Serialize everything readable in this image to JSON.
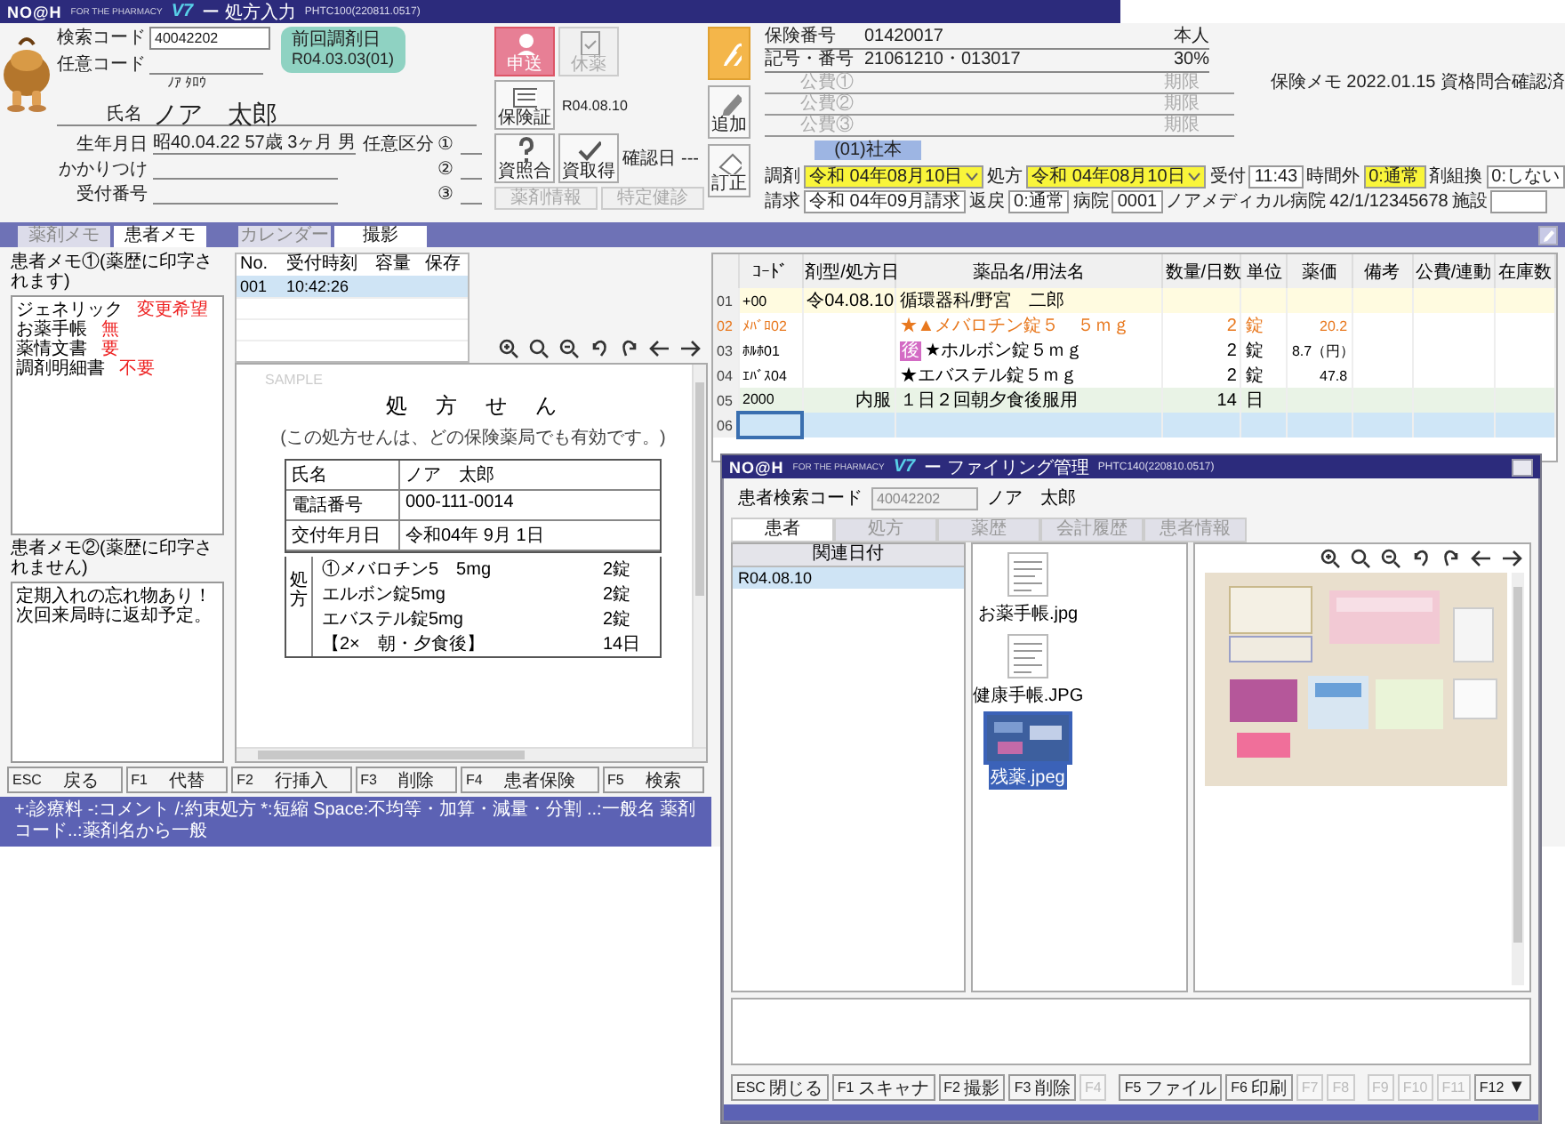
{
  "prescription_window": {
    "title_bar": {
      "logo": "NO@H",
      "tagline": "FOR THE PHARMACY",
      "badge": "V7",
      "title": "ー 処方入力",
      "build": "PHTC100(220811.0517)"
    },
    "patient": {
      "search_code_label": "検索コード",
      "search_code": "40042202",
      "optional_code_label": "任意コード",
      "kana": "ﾉｱ ﾀﾛｳ",
      "name_label": "氏名",
      "name": "ノア　太郎",
      "birth_label": "生年月日",
      "birth": "昭40.04.22 57歳 3ヶ月 男",
      "family_label": "かかりつけ",
      "reception_label": "受付番号",
      "category_label": "任意区分",
      "category_slots": [
        "①",
        "②",
        "③"
      ]
    },
    "last_dispense": {
      "label": "前回調剤日",
      "date": "R04.03.03(01)"
    },
    "buttons": [
      {
        "label": "申送",
        "kind": "person",
        "disabled": false
      },
      {
        "label": "休薬",
        "kind": "document",
        "disabled": true
      },
      {
        "label": "保険証",
        "kind": "card",
        "disabled": false
      },
      {
        "label": "資照合",
        "kind": "question",
        "disabled": false
      },
      {
        "label": "資取得",
        "kind": "check",
        "disabled": false
      },
      {
        "label": "薬剤情報",
        "kind": "plain",
        "disabled": true
      },
      {
        "label": "特定健診",
        "kind": "plain",
        "disabled": true
      }
    ],
    "card_date": "R04.08.10",
    "confirm_label": "確認日",
    "confirm_value": "---",
    "side_buttons": [
      {
        "kind": "clip",
        "highlighted": true
      },
      {
        "kind": "pencil",
        "label": "追加",
        "highlighted": false
      },
      {
        "kind": "eraser",
        "label": "訂正",
        "highlighted": false
      }
    ],
    "insurance": {
      "rows": [
        {
          "label": "保険番号",
          "value": "01420017",
          "extra": "本人"
        },
        {
          "label": "記号・番号",
          "value": "21061210・013017",
          "extra": "30%"
        }
      ],
      "public": [
        {
          "label": "公費①",
          "limit": "期限"
        },
        {
          "label": "公費②",
          "limit": "期限"
        },
        {
          "label": "公費③",
          "limit": "期限"
        }
      ],
      "memo_label": "保険メモ",
      "memo": "2022.01.15 資格問合確認済",
      "type": "(01)社本"
    },
    "dispense_rows": [
      {
        "fields": [
          {
            "label": "調剤",
            "value": "令和 04年08月10日",
            "kind": "dropdown",
            "highlighted": true
          },
          {
            "label": "処方",
            "value": "令和 04年08月10日",
            "kind": "dropdown",
            "highlighted": true
          },
          {
            "label": "受付",
            "value": "11:43",
            "kind": "input",
            "highlighted": false
          },
          {
            "label": "時間外",
            "value": "0:通常",
            "kind": "input",
            "highlighted": true
          },
          {
            "label": "剤組換",
            "value": "0:しない",
            "kind": "input",
            "highlighted": false
          }
        ]
      },
      {
        "fields": [
          {
            "label": "請求",
            "value": "令和 04年09月請求",
            "kind": "input",
            "highlighted": false
          },
          {
            "label": "返戻",
            "value": "0:通常",
            "kind": "input",
            "highlighted": false
          },
          {
            "label": "病院",
            "value": "0001",
            "kind": "input",
            "highlighted": false
          },
          {
            "value": "ノアメディカル病院",
            "kind": "text"
          },
          {
            "value": "42/1/12345678",
            "kind": "text"
          },
          {
            "label": "施設",
            "kind": "input",
            "highlighted": false
          }
        ]
      }
    ],
    "tabs_left": [
      {
        "label": "薬剤メモ",
        "selected": false
      },
      {
        "label": "患者メモ",
        "selected": true
      }
    ],
    "tabs_center": [
      {
        "label": "カレンダー",
        "selected": false
      },
      {
        "label": "撮影",
        "selected": true
      }
    ],
    "memo1": {
      "title": "患者メモ①(薬歴に印字されます)",
      "lines": [
        {
          "label": "ジェネリック",
          "value": "変更希望"
        },
        {
          "label": "お薬手帳",
          "value": "無"
        },
        {
          "label": "薬情文書",
          "value": "要"
        },
        {
          "label": "調剤明細書",
          "value": "不要"
        }
      ]
    },
    "memo2": {
      "title": "患者メモ②(薬歴に印字されません)",
      "lines": [
        "定期入れの忘れ物あり！",
        "次回来局時に返却予定。"
      ]
    },
    "captures": {
      "columns": [
        "No.",
        "受付時刻",
        "容量",
        "保存"
      ],
      "rows": [
        {
          "cells": [
            "001",
            "10:42:26"
          ],
          "selected": true
        }
      ]
    },
    "document": {
      "watermark": "SAMPLE",
      "title": "処　方　せ　ん",
      "note": "(この処方せんは、どの保険薬局でも有効です。)",
      "rows": [
        {
          "label": "氏名",
          "value": "ノア　太郎"
        },
        {
          "label": "電話番号",
          "value": "000-111-0014"
        },
        {
          "label": "交付年月日",
          "value": "令和04年 9月 1日"
        }
      ],
      "section_label": "処方",
      "items": [
        {
          "drug": "①メバロチン5　5mg",
          "amount": "2錠"
        },
        {
          "drug": "エルボン錠5mg",
          "amount": "2錠"
        },
        {
          "drug": "エバステル錠5mg",
          "amount": "2錠"
        },
        {
          "drug": "【2×　朝・夕食後】",
          "amount": "14日"
        }
      ]
    },
    "drugs": {
      "columns": [
        "ｺｰﾄﾞ",
        "剤型/処方日",
        "薬品名/用法名",
        "数量/日数",
        "単位",
        "薬価",
        "備考",
        "公費/連動",
        "在庫数"
      ],
      "rows": [
        {
          "no": "01",
          "kind": "doctor",
          "code": "+00",
          "form": "令04.08.10",
          "name": "循環器科/野宮　二郎",
          "selected": false
        },
        {
          "no": "02",
          "kind": "drug",
          "code": "ﾒﾊﾞﾛ02",
          "name": "★▲メバロチン錠５　５ｍｇ",
          "qty": "2",
          "unit": "錠",
          "price": "20.2",
          "alert": true,
          "selected": false
        },
        {
          "no": "03",
          "kind": "drug",
          "code": "ﾎﾙﾎ01",
          "badge": "後",
          "name": "★ホルボン錠５ｍｇ",
          "qty": "2",
          "unit": "錠",
          "price": "8.7（円）",
          "alert": false,
          "selected": false
        },
        {
          "no": "04",
          "kind": "drug",
          "code": "ｴﾊﾞｽ04",
          "name": "★エバステル錠５ｍｇ",
          "qty": "2",
          "unit": "錠",
          "price": "47.8",
          "alert": false,
          "selected": false
        },
        {
          "no": "05",
          "kind": "usage",
          "code": "2000",
          "form": "内服",
          "name": "１日２回朝夕食後服用",
          "qty": "14",
          "unit": "日",
          "selected": false
        },
        {
          "no": "06",
          "kind": "empty",
          "selected": true
        }
      ]
    },
    "fkeys": [
      {
        "key": "ESC",
        "label": "戻る"
      },
      {
        "key": "F1",
        "label": "代替"
      },
      {
        "key": "F2",
        "label": "行挿入"
      },
      {
        "key": "F3",
        "label": "削除"
      },
      {
        "key": "F4",
        "label": "患者保険"
      },
      {
        "key": "F5",
        "label": "検索"
      }
    ],
    "status": "+:診療料 -:コメント /:約束処方 *:短縮 Space:不均等・加算・減量・分割 ..:一般名 薬剤コード..:薬剤名から一般"
  },
  "filing_window": {
    "title_bar": {
      "logo": "NO@H",
      "tagline": "FOR THE PHARMACY",
      "badge": "V7",
      "title": "ー ファイリング管理",
      "build": "PHTC140(220810.0517)"
    },
    "search_label": "患者検索コード",
    "search_code": "40042202",
    "patient_name": "ノア　太郎",
    "tabs": [
      {
        "label": "患者",
        "selected": true
      },
      {
        "label": "処方",
        "selected": false
      },
      {
        "label": "薬歴",
        "selected": false
      },
      {
        "label": "会計履歴",
        "selected": false
      },
      {
        "label": "患者情報",
        "selected": false
      }
    ],
    "date_header": "関連日付",
    "dates": [
      {
        "label": "R04.08.10",
        "selected": true
      }
    ],
    "files": [
      {
        "name": "お薬手帳.jpg",
        "kind": "document",
        "selected": false
      },
      {
        "name": "健康手帳.JPG",
        "kind": "document",
        "selected": false
      },
      {
        "name": "残薬.jpeg",
        "selected": true
      }
    ],
    "fkeys": [
      {
        "key": "ESC",
        "label": "閉じる",
        "disabled": false
      },
      {
        "key": "F1",
        "label": "スキャナ",
        "disabled": false
      },
      {
        "key": "F2",
        "label": "撮影",
        "disabled": false
      },
      {
        "key": "F3",
        "label": "削除",
        "disabled": false
      },
      {
        "key": "F4",
        "disabled": true
      },
      {
        "key": "F5",
        "label": "ファイル",
        "disabled": false
      },
      {
        "key": "F6",
        "label": "印刷",
        "disabled": false
      },
      {
        "key": "F7",
        "disabled": true
      },
      {
        "key": "F8",
        "disabled": true
      },
      {
        "key": "F9",
        "disabled": true
      },
      {
        "key": "F10",
        "disabled": true
      },
      {
        "key": "F11",
        "disabled": true
      },
      {
        "key": "F12",
        "label": "▼",
        "disabled": false
      }
    ]
  }
}
